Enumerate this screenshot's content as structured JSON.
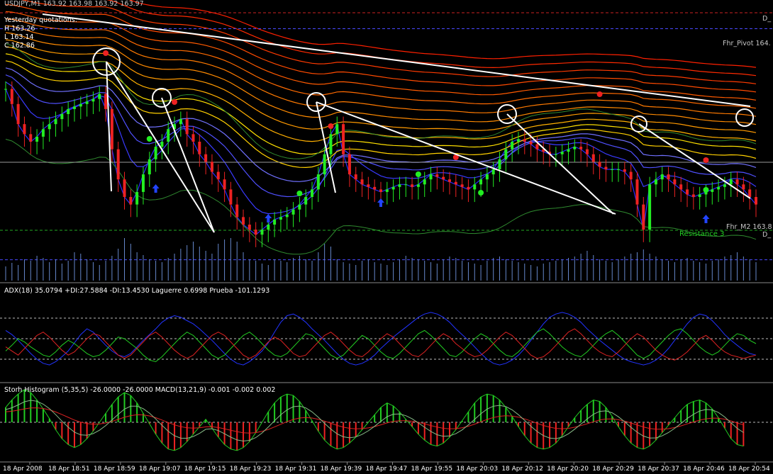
{
  "window": {
    "symbol_line": "USDJPY,M1 163.92 163.98 163.92 163.97"
  },
  "yesterday": {
    "title": "Yesterday quotations:",
    "high": "H 163.26",
    "low": "L 163.14",
    "close": "C 162.86"
  },
  "levels": {
    "d_top": "D_",
    "pivot": "Fhr_Pivot 164.",
    "m2": "Fhr_M2 163.8",
    "d_bottom": "D_",
    "resistance": "Resistance 3"
  },
  "adx_panel": {
    "label": "ADX(18) 35.0794 +DI:27.5884 -DI:13.4530  Laguerre 0.6998  Prueba -101.1293"
  },
  "stoch_panel": {
    "label": "Storh Histogram (5,35,5) -26.0000 -26.0000  MACD(13,21,9) -0.001 -0.002 0.002"
  },
  "x_ticks": [
    "18 Apr 2008",
    "18 Apr 18:51",
    "18 Apr 18:59",
    "18 Apr 19:07",
    "18 Apr 19:15",
    "18 Apr 19:23",
    "18 Apr 19:31",
    "18 Apr 19:39",
    "18 Apr 19:47",
    "18 Apr 19:55",
    "18 Apr 20:03",
    "18 Apr 20:12",
    "18 Apr 20:20",
    "18 Apr 20:29",
    "18 Apr 20:37",
    "18 Apr 20:46",
    "18 Apr 20:54"
  ],
  "colors": {
    "background": "#000000",
    "bull": "#22ee22",
    "bear": "#ee2222",
    "ribbon_fast": "#2222ff",
    "ribbon_slow": "#ff3300",
    "level_blue": "#4a4aff",
    "level_green": "#22aa22",
    "adx": "#2233ff",
    "plus_di": "#22cc22",
    "minus_di": "#dd2222"
  },
  "chart_data": [
    {
      "type": "candlestick",
      "panel": "price",
      "close": [
        163.76,
        163.7,
        163.62,
        163.58,
        163.55,
        163.57,
        163.6,
        163.62,
        163.64,
        163.66,
        163.68,
        163.69,
        163.7,
        163.71,
        163.72,
        163.74,
        163.68,
        163.52,
        163.4,
        163.33,
        163.3,
        163.35,
        163.42,
        163.48,
        163.53,
        163.55,
        163.6,
        163.62,
        163.64,
        163.58,
        163.55,
        163.5,
        163.47,
        163.43,
        163.4,
        163.36,
        163.3,
        163.25,
        163.22,
        163.2,
        163.18,
        163.2,
        163.22,
        163.24,
        163.25,
        163.26,
        163.28,
        163.3,
        163.33,
        163.36,
        163.42,
        163.5,
        163.58,
        163.62,
        163.5,
        163.42,
        163.4,
        163.38,
        163.37,
        163.36,
        163.35,
        163.36,
        163.37,
        163.38,
        163.38,
        163.37,
        163.38,
        163.4,
        163.42,
        163.41,
        163.4,
        163.39,
        163.38,
        163.37,
        163.36,
        163.38,
        163.4,
        163.42,
        163.44,
        163.48,
        163.52,
        163.55,
        163.56,
        163.55,
        163.54,
        163.52,
        163.51,
        163.5,
        163.5,
        163.51,
        163.52,
        163.53,
        163.52,
        163.5,
        163.47,
        163.45,
        163.44,
        163.44,
        163.44,
        163.43,
        163.4,
        163.3,
        163.2,
        163.38,
        163.4,
        163.42,
        163.4,
        163.38,
        163.36,
        163.34,
        163.33,
        163.34,
        163.35,
        163.36,
        163.37,
        163.38,
        163.4,
        163.38,
        163.36,
        163.33,
        163.3
      ],
      "y_range": [
        163.0,
        164.1
      ],
      "levels": {
        "pivot": 164.0,
        "m2": 163.08
      }
    },
    {
      "type": "bar",
      "panel": "volume",
      "values": [
        20,
        25,
        22,
        30,
        28,
        35,
        32,
        26,
        30,
        24,
        28,
        40,
        38,
        30,
        26,
        22,
        28,
        35,
        45,
        60,
        52,
        40,
        36,
        30,
        28,
        26,
        32,
        38,
        45,
        50,
        55,
        48,
        42,
        38,
        52,
        58,
        60,
        55,
        40,
        30,
        28,
        24,
        22,
        30,
        28,
        26,
        32,
        35,
        30,
        28,
        40,
        52,
        48,
        30,
        26,
        24,
        22,
        28,
        30,
        26,
        24,
        22,
        26,
        30,
        35,
        32,
        30,
        28,
        26,
        24,
        30,
        34,
        32,
        28,
        26,
        24,
        22,
        28,
        32,
        34,
        30,
        28,
        26,
        24,
        22,
        20,
        24,
        26,
        28,
        30,
        32,
        34,
        38,
        42,
        36,
        30,
        28,
        26,
        30,
        34,
        38,
        40,
        44,
        38,
        34,
        30,
        28,
        26,
        30,
        32,
        28,
        26,
        24,
        28,
        30,
        34,
        36,
        40,
        34,
        30,
        26,
        24,
        22,
        20,
        26,
        28,
        30
      ]
    },
    {
      "type": "line",
      "panel": "adx",
      "series": [
        {
          "name": "ADX(18)",
          "values": [
            60,
            55,
            48,
            40,
            32,
            25,
            20,
            18,
            22,
            28,
            35,
            45,
            55,
            62,
            58,
            50,
            42,
            35,
            30,
            28,
            32,
            40,
            48,
            55,
            62,
            70,
            75,
            78,
            76,
            72,
            68,
            62,
            55,
            48,
            40,
            32,
            25,
            20,
            18,
            22,
            28,
            35,
            45,
            58,
            70,
            78,
            80,
            76,
            70,
            62,
            55,
            48,
            40,
            32,
            25,
            20,
            18,
            20,
            24,
            30,
            38,
            45,
            52,
            58,
            64,
            70,
            76,
            80,
            82,
            80,
            76,
            70,
            62,
            55,
            48,
            40,
            32,
            25,
            20,
            18,
            20,
            24,
            30,
            38,
            48,
            58,
            68,
            76,
            80,
            82,
            80,
            76,
            70,
            62,
            55,
            48,
            42,
            36,
            30,
            25,
            22,
            20,
            18,
            20,
            24,
            30,
            38,
            48,
            58,
            68,
            76,
            80,
            78,
            72,
            64,
            55,
            48,
            42,
            36,
            32,
            30
          ]
        },
        {
          "name": "+DI",
          "values": [
            35,
            42,
            50,
            46,
            40,
            35,
            30,
            28,
            34,
            42,
            48,
            44,
            38,
            32,
            28,
            30,
            36,
            44,
            52,
            50,
            44,
            38,
            30,
            24,
            22,
            28,
            36,
            44,
            52,
            58,
            54,
            46,
            38,
            30,
            26,
            30,
            38,
            46,
            54,
            58,
            52,
            44,
            36,
            30,
            28,
            32,
            40,
            48,
            56,
            54,
            46,
            38,
            30,
            26,
            30,
            38,
            46,
            54,
            50,
            42,
            34,
            28,
            26,
            32,
            40,
            48,
            56,
            60,
            54,
            46,
            38,
            30,
            28,
            34,
            42,
            50,
            56,
            52,
            44,
            36,
            30,
            28,
            34,
            42,
            50,
            58,
            62,
            56,
            48,
            40,
            34,
            30,
            28,
            34,
            42,
            50,
            56,
            60,
            54,
            46,
            38,
            30,
            26,
            30,
            38,
            46,
            54,
            60,
            62,
            56,
            48,
            40,
            34,
            30,
            34,
            42,
            50,
            56,
            54,
            48,
            44
          ]
        },
        {
          "name": "-DI",
          "values": [
            40,
            35,
            30,
            38,
            46,
            54,
            58,
            52,
            44,
            36,
            30,
            34,
            42,
            50,
            56,
            54,
            46,
            38,
            30,
            26,
            30,
            38,
            46,
            54,
            58,
            52,
            44,
            36,
            30,
            26,
            30,
            38,
            46,
            54,
            58,
            54,
            46,
            38,
            30,
            26,
            30,
            38,
            46,
            52,
            48,
            40,
            32,
            28,
            30,
            38,
            46,
            54,
            58,
            52,
            44,
            36,
            30,
            28,
            34,
            42,
            50,
            56,
            52,
            44,
            36,
            30,
            28,
            34,
            42,
            50,
            56,
            52,
            44,
            38,
            32,
            28,
            30,
            36,
            44,
            52,
            58,
            54,
            46,
            38,
            30,
            26,
            28,
            34,
            42,
            50,
            58,
            62,
            56,
            48,
            40,
            34,
            30,
            28,
            34,
            42,
            50,
            56,
            52,
            44,
            36,
            30,
            26,
            24,
            28,
            34,
            42,
            50,
            54,
            48,
            40,
            34,
            30,
            28,
            26,
            28,
            30
          ]
        }
      ]
    },
    {
      "type": "bar",
      "panel": "stoch",
      "values": [
        20,
        30,
        38,
        44,
        40,
        30,
        18,
        5,
        -10,
        -22,
        -30,
        -34,
        -30,
        -22,
        -12,
        0,
        12,
        24,
        34,
        40,
        36,
        26,
        12,
        -2,
        -16,
        -28,
        -36,
        -38,
        -34,
        -26,
        -16,
        -6,
        4,
        -8,
        -20,
        -30,
        -36,
        -38,
        -34,
        -26,
        -14,
        0,
        14,
        26,
        34,
        38,
        36,
        28,
        16,
        2,
        -12,
        -24,
        -32,
        -36,
        -34,
        -28,
        -20,
        -10,
        0,
        10,
        20,
        26,
        22,
        14,
        4,
        -6,
        -16,
        -24,
        -30,
        -32,
        -28,
        -20,
        -10,
        2,
        14,
        26,
        34,
        38,
        36,
        30,
        20,
        8,
        -6,
        -18,
        -28,
        -34,
        -36,
        -34,
        -28,
        -18,
        -6,
        6,
        16,
        24,
        30,
        28,
        20,
        8,
        -6,
        -18,
        -28,
        -34,
        -36,
        -32,
        -24,
        -14,
        -4,
        6,
        16,
        24,
        28,
        30,
        26,
        18,
        6,
        -8,
        -22,
        -30,
        -32
      ]
    }
  ]
}
